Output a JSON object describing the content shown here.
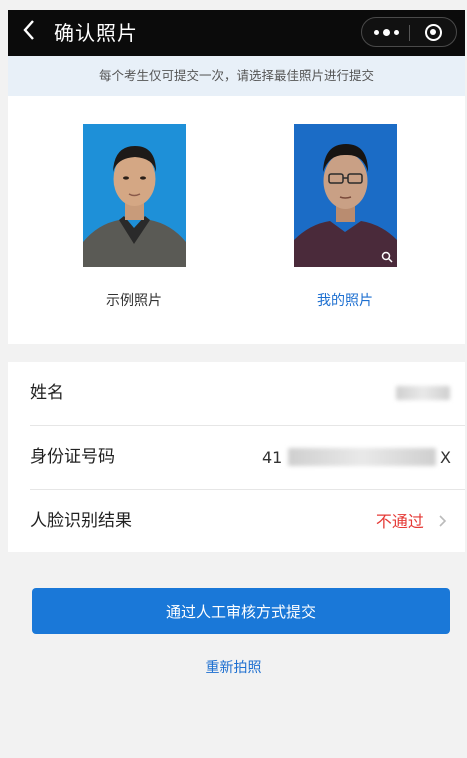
{
  "header": {
    "back_icon": "chevron-left-icon",
    "title": "确认照片",
    "more_icon": "more-dots-icon",
    "close_icon": "target-circle-icon"
  },
  "notice": {
    "text": "每个考生仅可提交一次，请选择最佳照片进行提交"
  },
  "photos": {
    "sample_label": "示例照片",
    "mine_label": "我的照片",
    "zoom_icon": "zoom-in-icon"
  },
  "info": {
    "name_label": "姓名",
    "id_label": "身份证号码",
    "id_prefix": "41",
    "id_suffix": "X",
    "face_label": "人脸识别结果",
    "face_result": "不通过",
    "face_result_color": "#e53935"
  },
  "actions": {
    "submit_label": "通过人工审核方式提交",
    "submit_color": "#1a78d8",
    "retake_label": "重新拍照"
  }
}
